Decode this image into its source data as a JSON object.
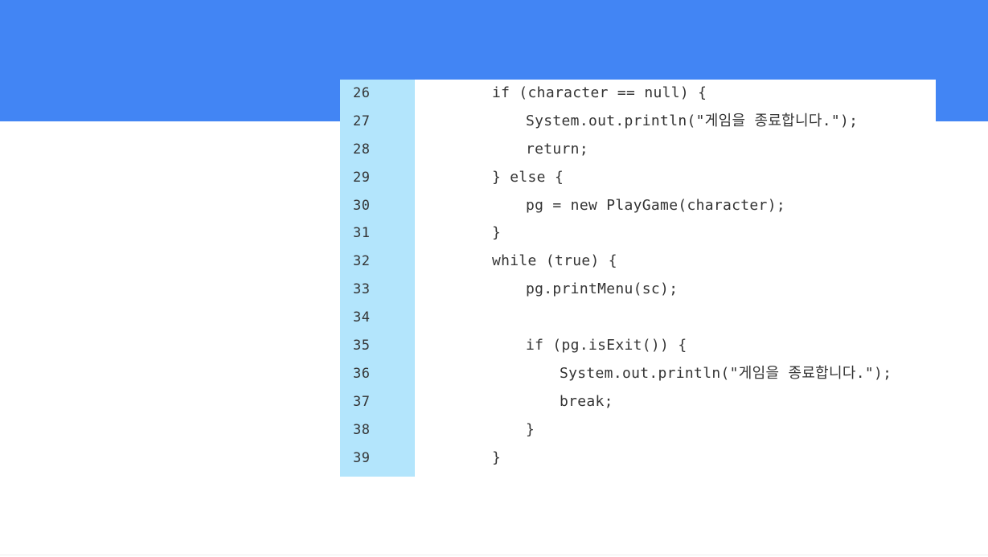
{
  "code": {
    "lines": [
      {
        "number": "26",
        "text": "if (character == null) {",
        "indent": 0
      },
      {
        "number": "27",
        "text": "System.out.println(\"게임을 종료합니다.\");",
        "indent": 1
      },
      {
        "number": "28",
        "text": "return;",
        "indent": 1
      },
      {
        "number": "29",
        "text": "} else {",
        "indent": 0
      },
      {
        "number": "30",
        "text": "pg = new PlayGame(character);",
        "indent": 1
      },
      {
        "number": "31",
        "text": "}",
        "indent": 0
      },
      {
        "number": "32",
        "text": "while (true) {",
        "indent": 0
      },
      {
        "number": "33",
        "text": "pg.printMenu(sc);",
        "indent": 1
      },
      {
        "number": "34",
        "text": "",
        "indent": 0
      },
      {
        "number": "35",
        "text": "if (pg.isExit()) {",
        "indent": 1
      },
      {
        "number": "36",
        "text": "System.out.println(\"게임을 종료합니다.\");",
        "indent": 2
      },
      {
        "number": "37",
        "text": "break;",
        "indent": 2
      },
      {
        "number": "38",
        "text": "}",
        "indent": 1
      },
      {
        "number": "39",
        "text": "}",
        "indent": 0
      }
    ]
  },
  "colors": {
    "header_band": "#4285f4",
    "gutter": "#b3e5fc",
    "code_text": "#333333",
    "background": "#ffffff"
  }
}
